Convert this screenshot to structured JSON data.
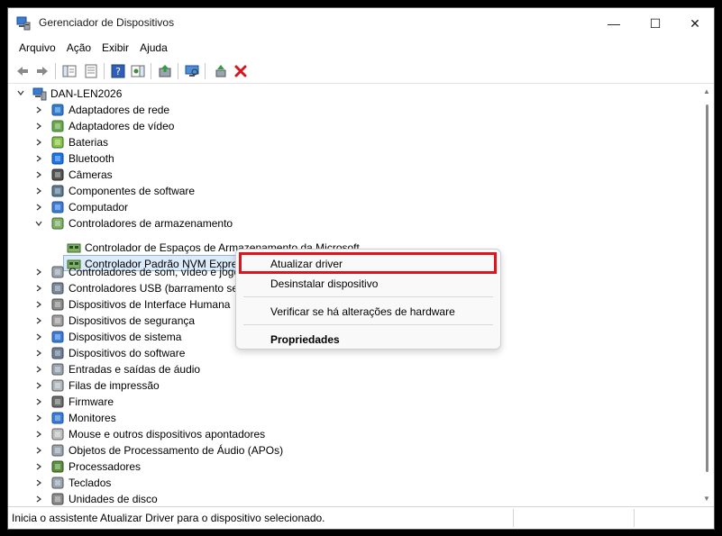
{
  "window": {
    "title": "Gerenciador de Dispositivos",
    "controls": {
      "minimize": "—",
      "maximize": "☐",
      "close": "✕"
    }
  },
  "menu": [
    "Arquivo",
    "Ação",
    "Exibir",
    "Ajuda"
  ],
  "toolbar": [
    "back-icon",
    "forward-icon",
    "show-hide-console-tree-icon",
    "properties-icon",
    "help-icon",
    "action-pane-icon",
    "update-driver-icon",
    "scan-hardware-icon",
    "enable-device-icon",
    "uninstall-device-icon"
  ],
  "tree": {
    "root": "DAN-LEN2026",
    "categories": [
      {
        "label": "Adaptadores de rede",
        "icon": "network-adapter-icon",
        "expanded": false
      },
      {
        "label": "Adaptadores de vídeo",
        "icon": "display-adapter-icon",
        "expanded": false
      },
      {
        "label": "Baterias",
        "icon": "battery-icon",
        "expanded": false
      },
      {
        "label": "Bluetooth",
        "icon": "bluetooth-icon",
        "expanded": false
      },
      {
        "label": "Câmeras",
        "icon": "camera-icon",
        "expanded": false
      },
      {
        "label": "Componentes de software",
        "icon": "software-component-icon",
        "expanded": false
      },
      {
        "label": "Computador",
        "icon": "computer-icon",
        "expanded": false
      },
      {
        "label": "Controladores de armazenamento",
        "icon": "storage-controller-icon",
        "expanded": true
      },
      {
        "label": "Controladores de som, vídeo e jogos",
        "icon": "sound-icon",
        "expanded": false
      },
      {
        "label": "Controladores USB (barramento serial universal)",
        "icon": "usb-icon",
        "expanded": false
      },
      {
        "label": "Dispositivos de Interface Humana",
        "icon": "hid-icon",
        "expanded": false
      },
      {
        "label": "Dispositivos de segurança",
        "icon": "security-device-icon",
        "expanded": false
      },
      {
        "label": "Dispositivos de sistema",
        "icon": "system-device-icon",
        "expanded": false
      },
      {
        "label": "Dispositivos do software",
        "icon": "software-device-icon",
        "expanded": false
      },
      {
        "label": "Entradas e saídas de áudio",
        "icon": "audio-io-icon",
        "expanded": false
      },
      {
        "label": "Filas de impressão",
        "icon": "print-queue-icon",
        "expanded": false
      },
      {
        "label": "Firmware",
        "icon": "firmware-icon",
        "expanded": false
      },
      {
        "label": "Monitores",
        "icon": "monitor-icon",
        "expanded": false
      },
      {
        "label": "Mouse e outros dispositivos apontadores",
        "icon": "mouse-icon",
        "expanded": false
      },
      {
        "label": "Objetos de Processamento de Áudio (APOs)",
        "icon": "apo-icon",
        "expanded": false
      },
      {
        "label": "Processadores",
        "icon": "processor-icon",
        "expanded": false
      },
      {
        "label": "Teclados",
        "icon": "keyboard-icon",
        "expanded": false
      },
      {
        "label": "Unidades de disco",
        "icon": "disk-drive-icon",
        "expanded": false
      }
    ],
    "storage_children": [
      "Controlador de Espaços de Armazenamento da Microsoft",
      "Controlador Padrão NVM Express"
    ]
  },
  "context_menu": {
    "update_driver": "Atualizar driver",
    "uninstall": "Desinstalar dispositivo",
    "scan": "Verificar se há alterações de hardware",
    "properties": "Propriedades"
  },
  "status": "Inicia o assistente Atualizar Driver para o dispositivo selecionado.",
  "colors": {
    "selection": "#dcebfa",
    "highlight_border": "#e0141f",
    "accent": "#1f6fc5"
  }
}
